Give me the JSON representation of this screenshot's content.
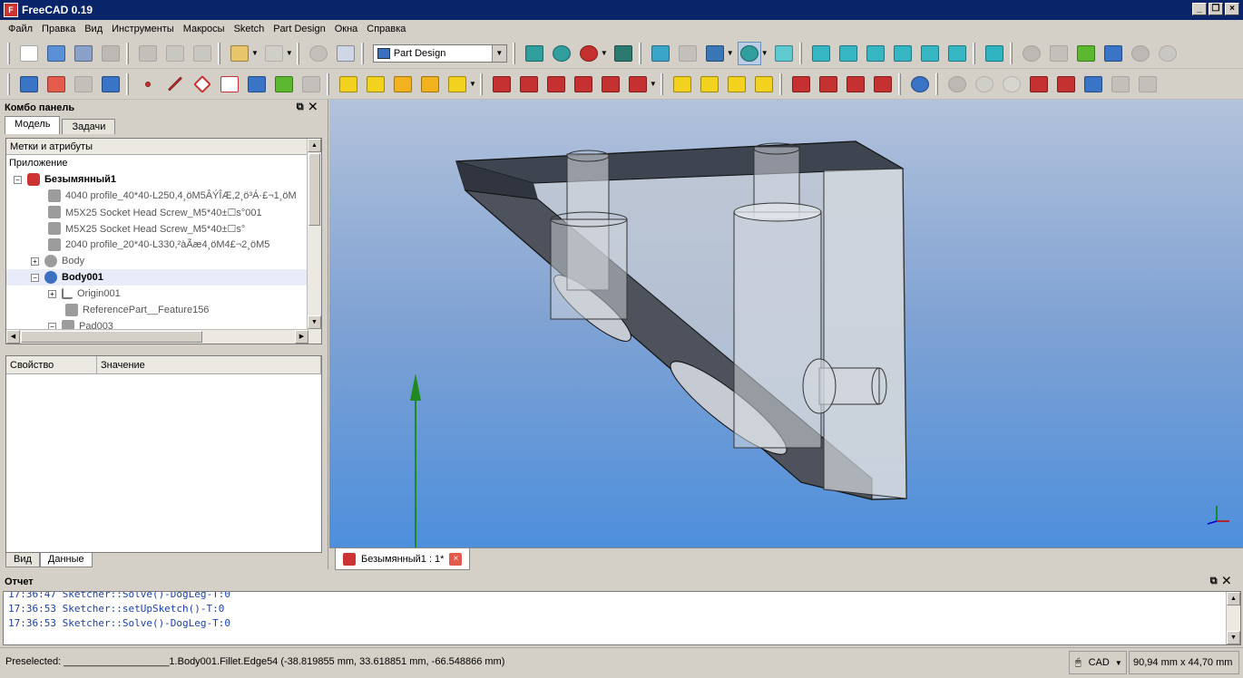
{
  "window": {
    "title": "FreeCAD 0.19",
    "app_icon": "freecad-icon"
  },
  "menu": [
    "Файл",
    "Правка",
    "Вид",
    "Инструменты",
    "Макросы",
    "Sketch",
    "Part Design",
    "Окна",
    "Справка"
  ],
  "toolbar": {
    "workbench_selected": "Part Design"
  },
  "combo": {
    "title": "Комбо панель",
    "tabs": [
      "Модель",
      "Задачи"
    ],
    "tree_header": "Метки и атрибуты",
    "tree": [
      {
        "label": "Приложение",
        "style": "plain"
      },
      {
        "label": "Безымянный1",
        "style": "bold"
      },
      {
        "label": "4040 profile_40*40-L250,4¸öM5ÂÝÎÆ,2¸ö³Á·£¬1¸öM",
        "style": "gray"
      },
      {
        "label": "M5X25 Socket Head Screw_M5*40±☐s°001",
        "style": "gray"
      },
      {
        "label": "M5X25 Socket Head Screw_M5*40±☐s°",
        "style": "gray"
      },
      {
        "label": "2040 profile_20*40-L330,²àÃæ4¸öM4£¬2¸öM5",
        "style": "gray"
      },
      {
        "label": "Body",
        "style": "gray"
      },
      {
        "label": "Body001",
        "style": "bold"
      },
      {
        "label": "Origin001",
        "style": "gray"
      },
      {
        "label": "ReferencePart__Feature156",
        "style": "gray"
      },
      {
        "label": "Pad003",
        "style": "gray"
      }
    ],
    "prop_headers": [
      "Свойство",
      "Значение"
    ],
    "bottom_tabs": [
      "Вид",
      "Данные"
    ]
  },
  "document_tab": "Безымянный1 : 1*",
  "report": {
    "title": "Отчет",
    "lines": [
      "17:36:47  Sketcher::Solve()-DogLeg-T:0",
      "17:36:53  Sketcher::setUpSketch()-T:0",
      "17:36:53  Sketcher::Solve()-DogLeg-T:0"
    ]
  },
  "status": {
    "preselected": "Preselected: ___________________1.Body001.Fillet.Edge54 (-38.819855 mm, 33.618851 mm, -66.548866 mm)",
    "nav_style": "CAD",
    "dimensions": "90,94 mm x 44,70 mm"
  },
  "colors": {
    "titlebar": "#0a246a",
    "view_top": "#b3c2db",
    "view_bottom": "#4e8fdc",
    "y_axis": "#1f8a1f",
    "log_text": "#1b3fa8"
  }
}
